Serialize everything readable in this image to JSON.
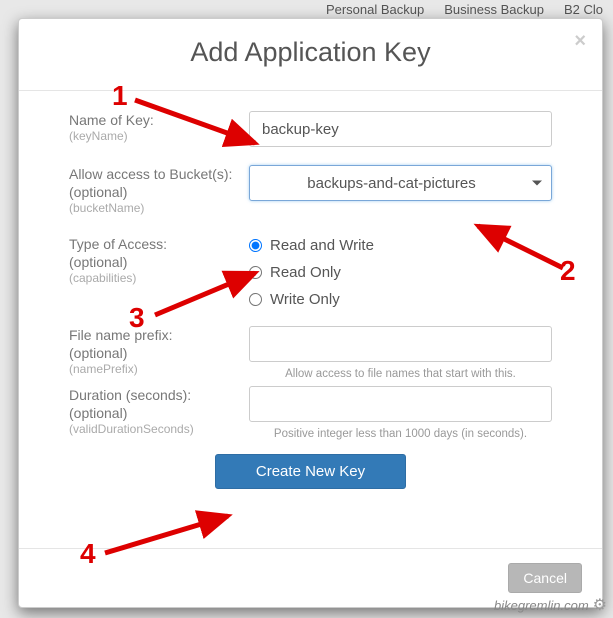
{
  "nav": {
    "item1": "Personal Backup",
    "item2": "Business Backup",
    "item3": "B2 Clo"
  },
  "modal": {
    "title": "Add Application Key",
    "close": "×"
  },
  "fields": {
    "name": {
      "label": "Name of Key:",
      "hint": "(keyName)",
      "value": "backup-key"
    },
    "bucket": {
      "label": "Allow access to Bucket(s):",
      "optional": "(optional)",
      "hint": "(bucketName)",
      "value": "backups-and-cat-pictures"
    },
    "access": {
      "label": "Type of Access:",
      "optional": "(optional)",
      "hint": "(capabilities)",
      "opt1": "Read and Write",
      "opt2": "Read Only",
      "opt3": "Write Only"
    },
    "prefix": {
      "label": "File name prefix:",
      "optional": "(optional)",
      "hint": "(namePrefix)",
      "below": "Allow access to file names that start with this."
    },
    "duration": {
      "label": "Duration (seconds):",
      "optional": "(optional)",
      "hint": "(validDurationSeconds)",
      "below": "Positive integer less than 1000 days (in seconds)."
    }
  },
  "buttons": {
    "create": "Create New Key",
    "cancel": "Cancel"
  },
  "annotations": {
    "n1": "1",
    "n2": "2",
    "n3": "3",
    "n4": "4"
  },
  "watermark": "bikegremlin.com"
}
